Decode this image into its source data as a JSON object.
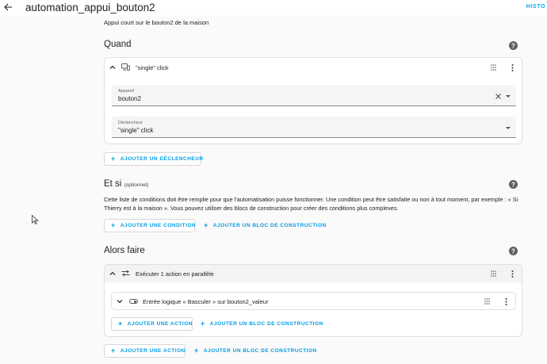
{
  "header": {
    "title": "automation_appui_bouton2",
    "history_label": "HISTO"
  },
  "description": "Appui court sur le bouton2 de la maison",
  "triggers_section": {
    "title": "Quand",
    "card_title": "\"single\" click",
    "device_field": {
      "label": "Appareil",
      "value": "bouton2"
    },
    "trigger_field": {
      "label": "Déclencheur",
      "value": "\"single\" click"
    },
    "add_trigger_label": "AJOUTER UN DÉCLENCHEUR"
  },
  "conditions_section": {
    "title": "Et si",
    "optional_label": "(optionnel)",
    "description": "Cette liste de conditions doit être remplie pour que l'automatisation puisse fonctionner. Une condition peut être satisfaite ou non à tout moment, par exemple : « Si Thierry est à la maison ». Vous pouvez utiliser des blocs de construction pour créer des conditions plus complexes.",
    "add_condition_label": "AJOUTER UNE CONDITION",
    "add_block_label": "AJOUTER UN BLOC DE CONSTRUCTION"
  },
  "actions_section": {
    "title": "Alors faire",
    "parallel_card_title": "Exécuter 1 action en parallèle",
    "inner_action_title": "Entrée logique « Basculer » sur bouton2_valeur",
    "inner_add_action_label": "AJOUTER UNE ACTION",
    "inner_add_block_label": "AJOUTER UN BLOC DE CONSTRUCTION",
    "add_action_label": "AJOUTER UNE ACTION",
    "add_block_label": "AJOUTER UN BLOC DE CONSTRUCTION"
  },
  "icons": {
    "back": "arrow-left-icon",
    "help": "help-circle-icon",
    "chevron_up": "chevron-up-icon",
    "chevron_down": "chevron-down-icon",
    "device": "remote-device-icon",
    "parallel": "shuffle-arrows-icon",
    "toggle": "toggle-switch-icon",
    "drag": "drag-grip-icon",
    "menu": "dots-vertical-icon",
    "clear": "close-icon",
    "plus": "plus-icon"
  },
  "colors": {
    "accent": "#039be5",
    "background": "#fafafa",
    "card": "#ffffff",
    "text": "#212121"
  }
}
